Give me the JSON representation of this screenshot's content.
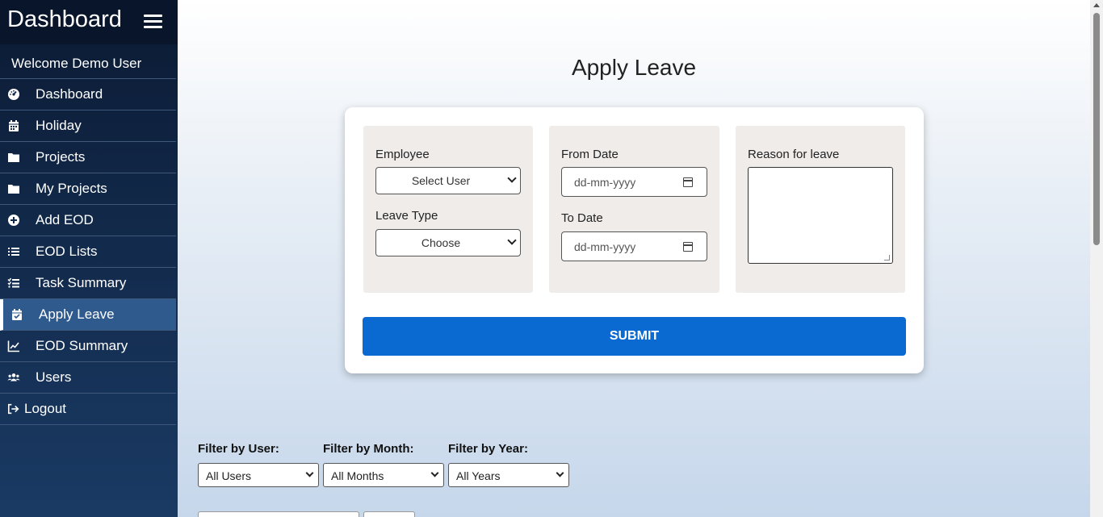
{
  "sidebar": {
    "title": "Dashboard",
    "welcome": "Welcome Demo User",
    "items": [
      {
        "label": "Dashboard",
        "icon": "gauge-icon"
      },
      {
        "label": "Holiday",
        "icon": "calendar-icon"
      },
      {
        "label": "Projects",
        "icon": "folder-icon"
      },
      {
        "label": "My Projects",
        "icon": "folder-icon"
      },
      {
        "label": "Add EOD",
        "icon": "plus-circle-icon"
      },
      {
        "label": "EOD Lists",
        "icon": "list-icon"
      },
      {
        "label": "Task Summary",
        "icon": "checklist-icon"
      },
      {
        "label": "Apply Leave",
        "icon": "calendar-check-icon"
      },
      {
        "label": "EOD Summary",
        "icon": "line-chart-icon"
      },
      {
        "label": "Users",
        "icon": "users-icon"
      },
      {
        "label": "Logout",
        "icon": "logout-icon"
      }
    ],
    "active_item": "Apply Leave"
  },
  "main": {
    "title": "Apply Leave",
    "form": {
      "employee_label": "Employee",
      "employee_value": "Select User",
      "leave_type_label": "Leave Type",
      "leave_type_value": "Choose",
      "from_date_label": "From Date",
      "from_date_placeholder": "dd-mm-yyyy",
      "to_date_label": "To Date",
      "to_date_placeholder": "dd-mm-yyyy",
      "reason_label": "Reason for leave",
      "reason_value": "",
      "submit_label": "SUBMIT"
    },
    "filters": [
      {
        "label": "Filter by User:",
        "value": "All Users"
      },
      {
        "label": "Filter by Month:",
        "value": "All Months"
      },
      {
        "label": "Filter by Year:",
        "value": "All Years"
      }
    ]
  },
  "colors": {
    "accent": "#0a6ad1",
    "sidebar_bg": "#112848",
    "sidebar_active": "#2f5a8e",
    "panel_bg": "#efecea"
  }
}
